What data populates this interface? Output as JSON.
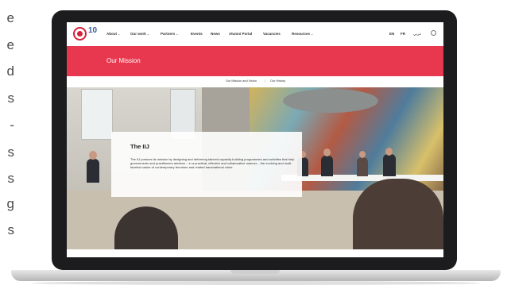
{
  "left_text_fragments": [
    "e",
    "e",
    "d",
    "s",
    "-",
    "s",
    "s",
    "g",
    "s"
  ],
  "nav": {
    "logo_number": "10",
    "items": [
      {
        "label": "About",
        "has_chevron": true
      },
      {
        "label": "Our work",
        "has_chevron": true
      },
      {
        "label": "Partners",
        "has_chevron": true
      },
      {
        "label": "Events",
        "has_chevron": false
      },
      {
        "label": "News",
        "has_chevron": false
      },
      {
        "label": "Alumni Portal",
        "has_chevron": false
      },
      {
        "label": "Vacancies",
        "has_chevron": false
      },
      {
        "label": "Resources",
        "has_chevron": true
      }
    ],
    "languages": [
      "EN",
      "FR",
      "عربي"
    ]
  },
  "banner": {
    "title": "Our Mission",
    "color": "#e8384f"
  },
  "subnav": {
    "items": [
      "Our Mission and Vision",
      "|",
      "Our History"
    ]
  },
  "card": {
    "title": "The IIJ",
    "body": "The IIJ pursues its mission by designing and delivering tailored capacity-building programmes and activities that help governments and practitioners address – in a practical, effective and collaborative manner – the evolving and multi-faceted nature of contemporary terrorism and related transnational crime."
  },
  "icons": {
    "search": "search-icon",
    "logo": "iij-logo-icon",
    "chevron": "chevron-down-icon"
  }
}
